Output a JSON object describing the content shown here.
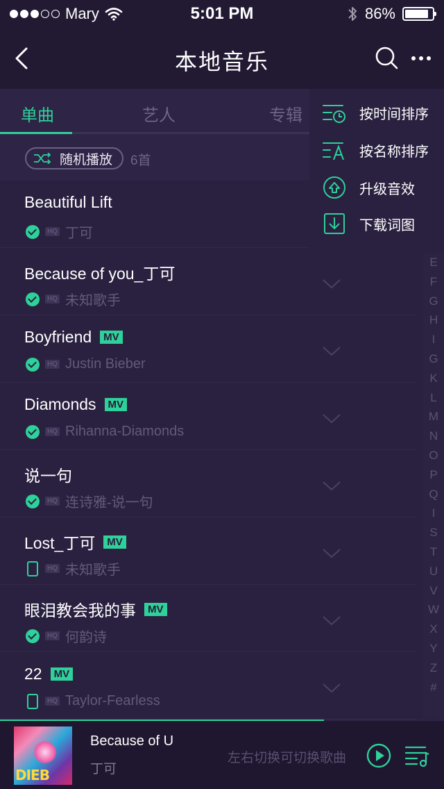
{
  "status_bar": {
    "carrier": "Mary",
    "time": "5:01 PM",
    "battery": "86%",
    "battery_level": 0.86
  },
  "nav": {
    "title": "本地音乐"
  },
  "tabs": [
    {
      "label": "单曲",
      "active": true
    },
    {
      "label": "艺人",
      "active": false
    },
    {
      "label": "专辑",
      "active": false
    }
  ],
  "shuffle": {
    "label": "随机播放",
    "count": "6首"
  },
  "songs": [
    {
      "title": "Beautiful Lift",
      "artist": "丁可",
      "mv": "",
      "source": "check"
    },
    {
      "title": "Because of you_丁可",
      "artist": "未知歌手",
      "mv": "",
      "source": "check"
    },
    {
      "title": "Boyfriend",
      "artist": "Justin Bieber",
      "mv": "MV",
      "source": "check"
    },
    {
      "title": "Diamonds",
      "artist": "Rihanna-Diamonds",
      "mv": "MV",
      "source": "check"
    },
    {
      "title": "说一句",
      "artist": "连诗雅-说一句",
      "mv": "",
      "source": "check"
    },
    {
      "title": "Lost_丁可",
      "artist": "未知歌手",
      "mv": "MV",
      "source": "phone"
    },
    {
      "title": "眼泪教会我的事",
      "artist": "何韵诗",
      "mv": "MV",
      "source": "check"
    },
    {
      "title": "22",
      "artist": "Taylor-Fearless",
      "mv": "MV",
      "source": "phone"
    }
  ],
  "hq_label": "HQ",
  "alpha_index": [
    "E",
    "F",
    "G",
    "H",
    "I",
    "G",
    "K",
    "L",
    "M",
    "N",
    "O",
    "P",
    "Q",
    "I",
    "S",
    "T",
    "U",
    "V",
    "W",
    "X",
    "Y",
    "Z",
    "#"
  ],
  "menu": {
    "items": [
      {
        "label": "按时间排序",
        "icon": "sort-by-time-icon"
      },
      {
        "label": "按名称排序",
        "icon": "sort-by-name-icon"
      },
      {
        "label": "升级音效",
        "icon": "upgrade-sound-icon"
      },
      {
        "label": "下载词图",
        "icon": "download-lyrics-icon"
      }
    ]
  },
  "player": {
    "title": "Because of U",
    "artist": "丁可",
    "hint": "左右切换可切换歌曲",
    "progress": 0.73,
    "art_text": "DIEB"
  },
  "colors": {
    "accent": "#2ed19a",
    "background": "#2a2140",
    "bar": "#221a33"
  }
}
